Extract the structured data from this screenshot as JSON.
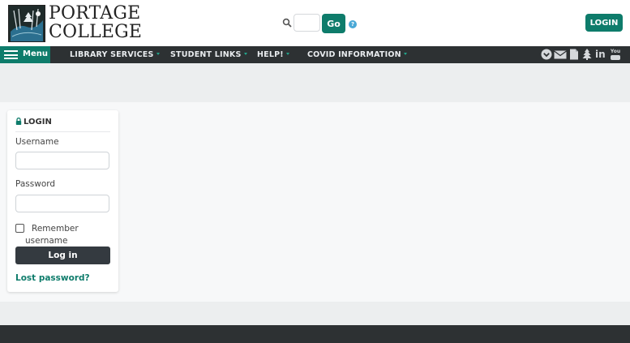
{
  "header": {
    "logo": {
      "line1": "PORTAGE",
      "line2": "COLLEGE"
    },
    "search": {
      "placeholder": "",
      "go_label": "Go"
    },
    "help_glyph": "?",
    "login_label": "LOGIN"
  },
  "nav": {
    "menu_label": "Menu",
    "items": [
      {
        "label": "LIBRARY SERVICES"
      },
      {
        "label": "STUDENT LINKS"
      },
      {
        "label": "HELP!"
      },
      {
        "label": "COVID INFORMATION"
      }
    ],
    "social": [
      "chevron-down-circle-icon",
      "mail-icon",
      "document-icon",
      "tree-icon",
      "linkedin-icon",
      "youtube-icon"
    ],
    "linkedin_glyph": "in",
    "youtube_glyph": "You"
  },
  "login_card": {
    "title": "LOGIN",
    "username_label": "Username",
    "username_value": "",
    "password_label": "Password",
    "password_value": "",
    "remember_label": "Remember username",
    "login_button": "Log in",
    "lost_password": "Lost password?"
  },
  "colors": {
    "accent": "#0e7c6b",
    "nav_bg": "#2d3133",
    "button_dark": "#343a40",
    "caret": "#22a58c",
    "help": "#49a8d6"
  }
}
